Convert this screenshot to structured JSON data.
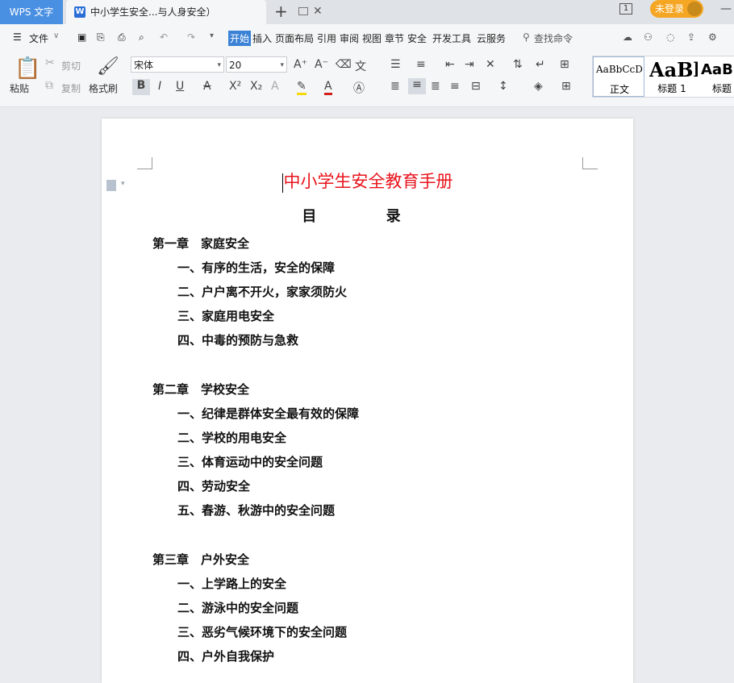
{
  "titlebar": {
    "app_tab": "WPS 文字",
    "doc_tab_title": "中小学生安全...与人身安全）",
    "doc_icon_letter": "W",
    "window_number": "1",
    "login_label": "未登录"
  },
  "menubar": {
    "file": "文件",
    "tabs": [
      "开始",
      "插入",
      "页面布局",
      "引用",
      "审阅",
      "视图",
      "章节",
      "安全",
      "开发工具",
      "云服务"
    ],
    "search_placeholder": "查找命令"
  },
  "ribbon": {
    "paste": "粘贴",
    "cut": "剪切",
    "copy": "复制",
    "format_painter": "格式刷",
    "font_name": "宋体",
    "font_size": "20",
    "styles": [
      {
        "preview": "AaBbCcDd",
        "label": "正文"
      },
      {
        "preview": "AaBl",
        "label": "标题 1"
      },
      {
        "preview": "AaB",
        "label": "标题"
      }
    ]
  },
  "document": {
    "title": "中小学生安全教育手册",
    "toc_heading": "目 录",
    "toc": [
      {
        "kind": "chapter",
        "text": "第一章　家庭安全"
      },
      {
        "kind": "sub",
        "text": "一、有序的生活，安全的保障"
      },
      {
        "kind": "sub",
        "text": "二、户户离不开火，家家须防火"
      },
      {
        "kind": "sub",
        "text": "三、家庭用电安全"
      },
      {
        "kind": "sub",
        "text": "四、中毒的预防与急救"
      },
      {
        "kind": "chapter",
        "text": "第二章　学校安全"
      },
      {
        "kind": "sub",
        "text": "一、纪律是群体安全最有效的保障"
      },
      {
        "kind": "sub",
        "text": "二、学校的用电安全"
      },
      {
        "kind": "sub",
        "text": "三、体育运动中的安全问题"
      },
      {
        "kind": "sub",
        "text": "四、劳动安全"
      },
      {
        "kind": "sub",
        "text": "五、春游、秋游中的安全问题"
      },
      {
        "kind": "chapter",
        "text": "第三章　户外安全"
      },
      {
        "kind": "sub",
        "text": "一、上学路上的安全"
      },
      {
        "kind": "sub",
        "text": "二、游泳中的安全问题"
      },
      {
        "kind": "sub",
        "text": "三、恶劣气候环境下的安全问题"
      },
      {
        "kind": "sub",
        "text": "四、户外自我保护"
      }
    ]
  },
  "colors": {
    "title_red": "#e8141c",
    "accent_blue": "#3b82d6",
    "login_orange": "#f5a623"
  }
}
